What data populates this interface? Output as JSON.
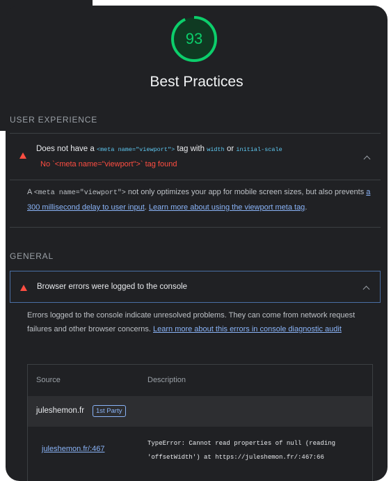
{
  "score": {
    "value": "93",
    "fraction": 0.93,
    "color": "#0cce6b"
  },
  "category_title": "Best Practices",
  "sections": {
    "ux_label": "USER EXPERIENCE",
    "general_label": "GENERAL"
  },
  "viewport_audit": {
    "title_prefix": "Does not have a",
    "title_code": "<meta name=\"viewport\">",
    "title_mid": "tag with",
    "title_code2": "width",
    "title_or": "or",
    "title_code3": "initial-scale",
    "fail_text": "No `<meta name=\"viewport\">` tag found",
    "desc_prefix": "A",
    "desc_code": "<meta name=\"viewport\">",
    "desc_mid": "not only optimizes your app for mobile screen sizes, but also prevents",
    "desc_link1": "a 300 millisecond delay to user input",
    "desc_sep": ".",
    "desc_link2": "Learn more about using the viewport meta tag",
    "desc_end": "."
  },
  "console_audit": {
    "title": "Browser errors were logged to the console",
    "desc_text": "Errors logged to the console indicate unresolved problems. They can come from network request failures and other browser concerns.",
    "desc_link": "Learn more about this errors in console diagnostic audit",
    "table": {
      "col_source": "Source",
      "col_description": "Description",
      "group_name": "juleshemon.fr",
      "group_badge": "1st Party",
      "row_source": "juleshemon.fr/:467",
      "row_description": "TypeError: Cannot read properties of null (reading 'offsetWidth') at https://juleshemon.fr/:467:66"
    }
  },
  "colors": {
    "background": "#202124",
    "fail": "#ff4e42",
    "link": "#8ab4f8",
    "code": "#5ec8f1",
    "pass": "#0cce6b"
  },
  "icons": [
    "fail-triangle-icon",
    "chevron-up-icon"
  ]
}
